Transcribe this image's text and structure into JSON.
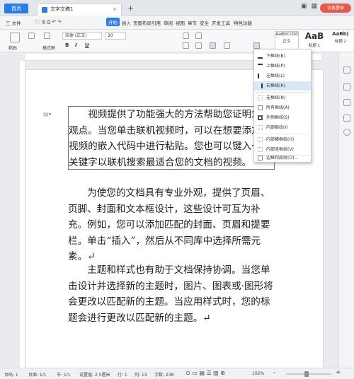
{
  "titlebar": {
    "home_tab": "首页",
    "doc_tab": "文字文稿1",
    "close": "×",
    "new_tab": "+",
    "login": "访客登录"
  },
  "menu": {
    "file": "三 文件",
    "items": [
      "开始",
      "插入",
      "页面布局",
      "引用",
      "审阅",
      "视图",
      "章节",
      "安全",
      "开发工具",
      "特色功能"
    ]
  },
  "ribbon": {
    "paste": "粘贴",
    "format_brush": "格式刷",
    "font": "宋体 (正文)",
    "font_size": "20",
    "bold": "B",
    "italic": "I",
    "underline": "U",
    "styles": [
      {
        "preview": "AaBbCcDd",
        "label": "正文"
      },
      {
        "preview": "AaB",
        "label": "标题 1"
      },
      {
        "preview": "AaBb(",
        "label": "标题 2"
      }
    ]
  },
  "document": {
    "paragraphs": [
      "视频提供了功能强大的方法帮助您证明您的观点。当您单击联机视频时，可以在想要添加的视频的嵌入代码中进行粘贴。您也可以键入一个关键字以联机搜索最适合您的文档的视频。",
      "为使您的文档具有专业外观，提供了页眉、页脚、封面和文本框设计，这些设计可互为补充。例如，您可以添加匹配的封面、页眉和提要栏。单击“插入”，然后从不同库中选择所需元素。↵",
      "主题和样式也有助于文档保持协调。当您单击设计并选择新的主题时，图片、图表或·图形将会更改以匹配新的主题。当应用样式时，您的标题会进行更改以匹配新的主题。↵"
    ]
  },
  "border_menu": {
    "items": [
      "下框线(B)",
      "上框线(P)",
      "左框线(L)",
      "右框线(R)",
      "无框线(N)",
      "所有框线(A)",
      "外侧框线(S)",
      "内部框线(I)",
      "内部横框线(H)",
      "内部竖框线(V)",
      "边框和底纹(O)..."
    ],
    "selected_index": 3
  },
  "statusbar": {
    "page": "页码: 1",
    "pages": "页面: 1/1",
    "section": "节: 1/1",
    "setting": "设置值: 2.5厘米",
    "row": "行: 1",
    "col": "列: 13",
    "words": "字数: 238",
    "zoom": "102%",
    "zoom_out": "-",
    "zoom_in": "+"
  },
  "colors": {
    "accent": "#2d7be5",
    "login": "#e35a4f",
    "menu_selected": "#dbe7f7"
  }
}
